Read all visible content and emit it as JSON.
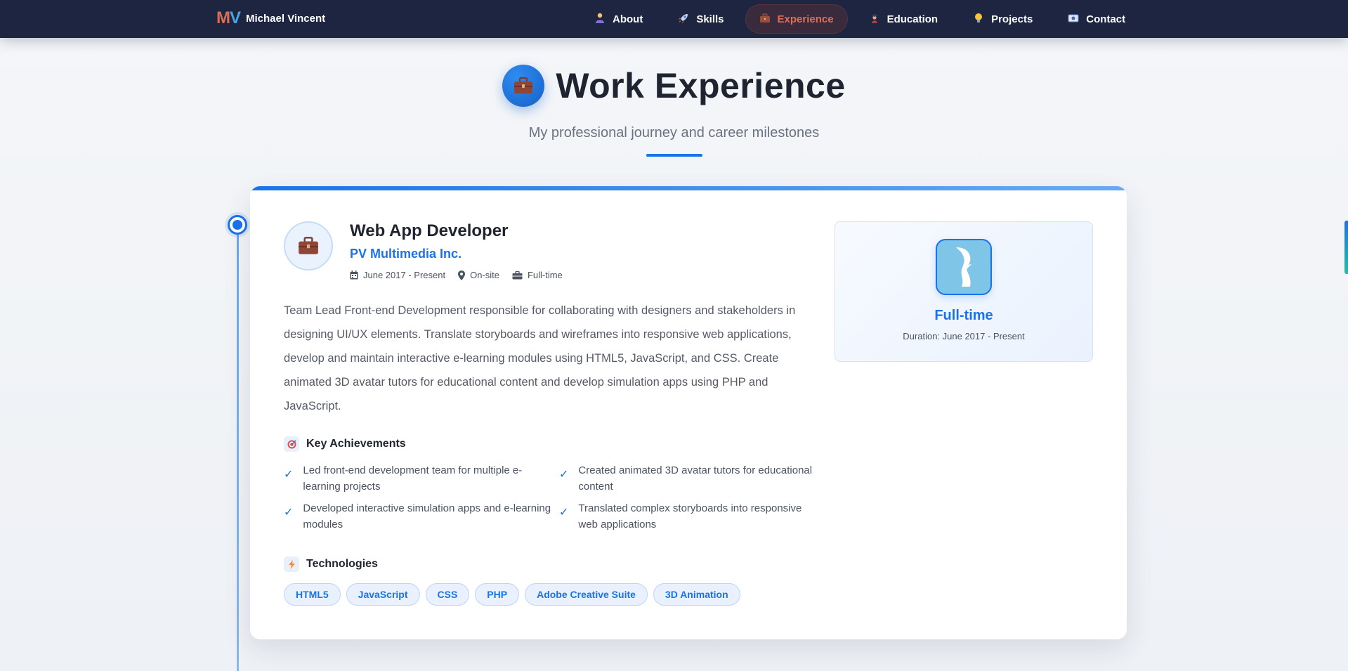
{
  "nav": {
    "brand_logo_m": "M",
    "brand_logo_v": "V",
    "brand_name": "Michael Vincent",
    "items": [
      {
        "label": "About",
        "icon": "person-icon"
      },
      {
        "label": "Skills",
        "icon": "rocket-icon"
      },
      {
        "label": "Experience",
        "icon": "briefcase-icon",
        "active": true
      },
      {
        "label": "Education",
        "icon": "graduation-cap-icon"
      },
      {
        "label": "Projects",
        "icon": "lightbulb-icon"
      },
      {
        "label": "Contact",
        "icon": "id-card-icon"
      }
    ]
  },
  "header": {
    "title": "Work Experience",
    "subtitle": "My professional journey and career milestones"
  },
  "job": {
    "title": "Web App Developer",
    "company": "PV Multimedia Inc.",
    "period": "June 2017 - Present",
    "location": "On-site",
    "type": "Full-time",
    "description": "Team Lead Front-end Development responsible for collaborating with designers and stakeholders in designing UI/UX elements. Translate storyboards and wireframes into responsive web applications, develop and maintain interactive e-learning modules using HTML5, JavaScript, and CSS. Create animated 3D avatar tutors for educational content and develop simulation apps using PHP and JavaScript.",
    "achievements_heading": "Key Achievements",
    "achievements": [
      "Led front-end development team for multiple e-learning projects",
      "Created animated 3D avatar tutors for educational content",
      "Developed interactive simulation apps and e-learning modules",
      "Translated complex storyboards into responsive web applications"
    ],
    "technologies_heading": "Technologies",
    "technologies": [
      "HTML5",
      "JavaScript",
      "CSS",
      "PHP",
      "Adobe Creative Suite",
      "3D Animation"
    ]
  },
  "panel": {
    "type": "Full-time",
    "duration": "Duration: June 2017 - Present"
  },
  "colors": {
    "nav_bg": "#1d2541",
    "accent": "#1a73e8",
    "active_nav": "#e36b55"
  }
}
